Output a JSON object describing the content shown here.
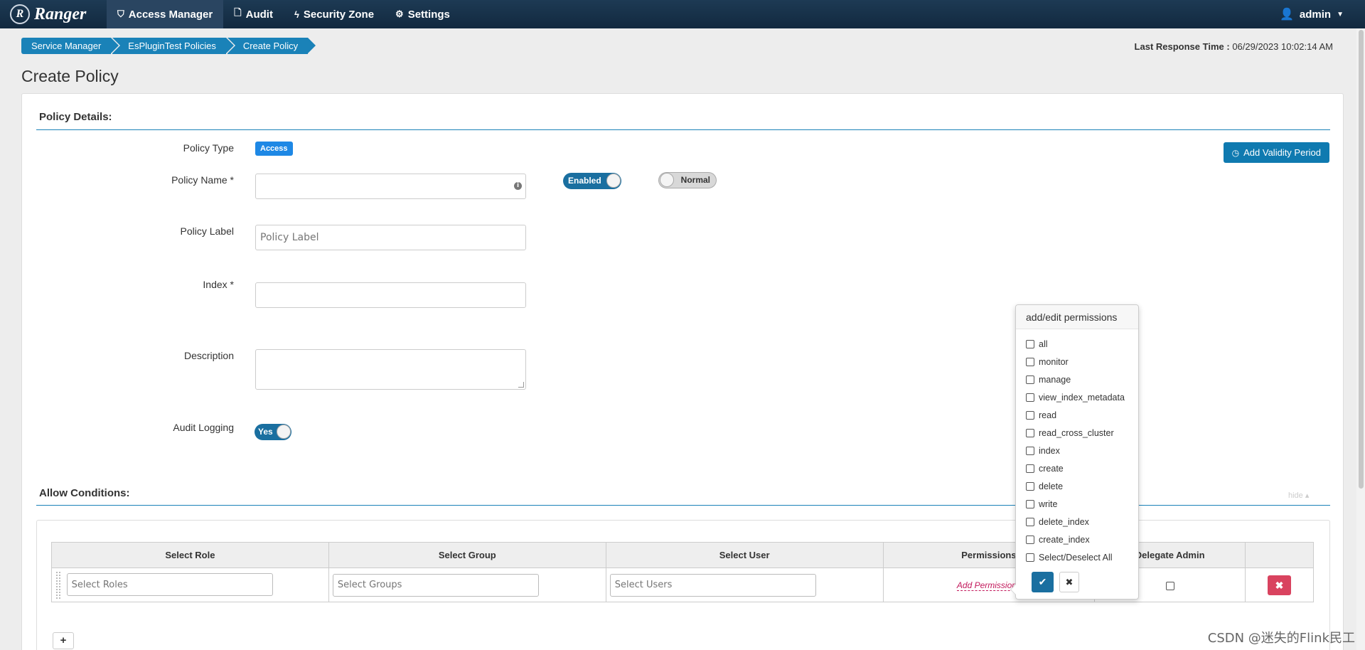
{
  "navbar": {
    "brand": "Ranger",
    "brand_logo": "R",
    "items": [
      {
        "label": "Access Manager",
        "icon": "shield-icon"
      },
      {
        "label": "Audit",
        "icon": "file-icon"
      },
      {
        "label": "Security Zone",
        "icon": "bolt-icon"
      },
      {
        "label": "Settings",
        "icon": "gear-icon"
      }
    ],
    "user": "admin"
  },
  "breadcrumb": [
    "Service Manager",
    "EsPluginTest Policies",
    "Create Policy"
  ],
  "last_response": {
    "label": "Last Response Time :",
    "value": "06/29/2023 10:02:14 AM"
  },
  "page_title": "Create Policy",
  "policy_details": {
    "heading": "Policy Details:",
    "policy_type_label": "Policy Type",
    "policy_type_badge": "Access",
    "policy_name_label": "Policy Name *",
    "policy_name_value": "",
    "enabled_toggle": "Enabled",
    "normal_toggle": "Normal",
    "policy_label_label": "Policy Label",
    "policy_label_placeholder": "Policy Label",
    "index_label": "Index *",
    "description_label": "Description",
    "audit_logging_label": "Audit Logging",
    "audit_logging_toggle": "Yes",
    "add_validity_button": "Add Validity Period"
  },
  "allow_conditions": {
    "heading": "Allow Conditions:",
    "hide_link": "hide",
    "columns": [
      "Select Role",
      "Select Group",
      "Select User",
      "Permissions",
      "Delegate Admin",
      ""
    ],
    "row": {
      "roles_placeholder": "Select Roles",
      "groups_placeholder": "Select Groups",
      "users_placeholder": "Select Users",
      "add_permissions": "Add Permissions"
    },
    "add_row_button": "+"
  },
  "permissions_popover": {
    "title": "add/edit permissions",
    "options": [
      "all",
      "monitor",
      "manage",
      "view_index_metadata",
      "read",
      "read_cross_cluster",
      "index",
      "create",
      "delete",
      "write",
      "delete_index",
      "create_index",
      "Select/Deselect All"
    ]
  },
  "watermark": "CSDN @迷失的Flink民工",
  "colors": {
    "navbar": "#1d3a54",
    "accent": "#1a82b8",
    "danger": "#d9435f",
    "link": "#c2185b"
  }
}
